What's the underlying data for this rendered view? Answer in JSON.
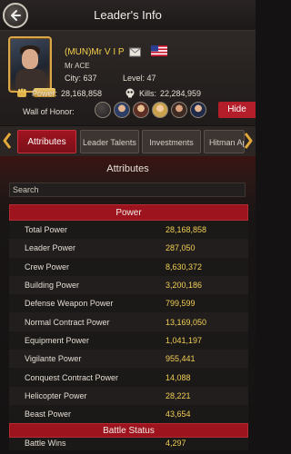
{
  "header": {
    "title": "Leader's Info",
    "back_icon": "back-arrow-icon"
  },
  "profile": {
    "name": "(MUN)Mr V I P",
    "subname": "Mr ACE",
    "city_label": "City:",
    "city_value": "637",
    "level_label": "Level:",
    "level_value": "47",
    "power_label": "Power:",
    "power_value": "28,168,858",
    "kills_label": "Kills:",
    "kills_value": "22,284,959",
    "wall_label": "Wall of Honor:",
    "hide_label": "Hide",
    "flag": "usa-flag-icon"
  },
  "tabs": [
    {
      "label": "Attributes",
      "active": true
    },
    {
      "label": "Leader Talents",
      "active": false
    },
    {
      "label": "Investments",
      "active": false
    },
    {
      "label": "Hitman Ap",
      "active": false
    }
  ],
  "content": {
    "section_title": "Attributes",
    "search_placeholder": "Search",
    "power_header": "Power",
    "rows": [
      {
        "label": "Total Power",
        "value": "28,168,858"
      },
      {
        "label": "Leader Power",
        "value": "287,050"
      },
      {
        "label": "Crew Power",
        "value": "8,630,372"
      },
      {
        "label": "Building Power",
        "value": "3,200,186"
      },
      {
        "label": "Defense Weapon Power",
        "value": "799,599"
      },
      {
        "label": "Normal Contract Power",
        "value": "13,169,050"
      },
      {
        "label": "Equipment Power",
        "value": "1,041,197"
      },
      {
        "label": "Vigilante Power",
        "value": "955,441"
      },
      {
        "label": "Conquest Contract Power",
        "value": "14,088"
      },
      {
        "label": "Helicopter Power",
        "value": "28,221"
      },
      {
        "label": "Beast Power",
        "value": "43,654"
      }
    ],
    "battle_header": "Battle Status",
    "battle_rows": [
      {
        "label": "Battle Wins",
        "value": "4,297"
      }
    ]
  },
  "colors": {
    "accent_red": "#9e141e",
    "gold_value": "#f1cf53",
    "name_gold": "#f5cf4c"
  }
}
